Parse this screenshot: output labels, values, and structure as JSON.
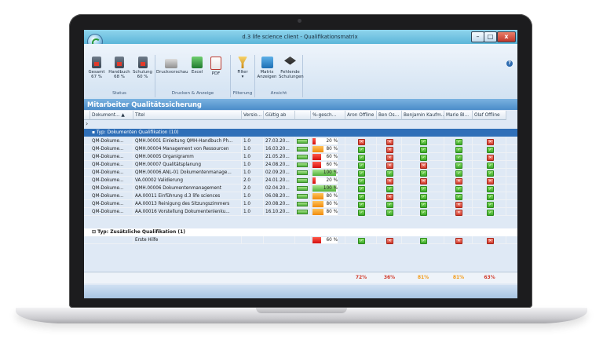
{
  "window": {
    "title": "d.3 life science client - Qualifikationsmatrix",
    "minimize": "–",
    "maximize": "□",
    "close": "x",
    "help": "?"
  },
  "ribbon": {
    "status": {
      "caption": "Status",
      "buttons": [
        {
          "label": "Gesamt",
          "value": "67 %"
        },
        {
          "label": "Handbuch",
          "value": "68 %"
        },
        {
          "label": "Schulung",
          "value": "60 %"
        }
      ]
    },
    "drucken": {
      "caption": "Drucken & Anzeige",
      "buttons": [
        {
          "label": "Druckvorschau"
        },
        {
          "label": "Excel"
        },
        {
          "label": "PDF"
        }
      ]
    },
    "filterung": {
      "caption": "Filterung",
      "buttons": [
        {
          "label": "Filter"
        }
      ]
    },
    "ansicht": {
      "caption": "Ansicht",
      "buttons": [
        {
          "label": "Matrix",
          "label2": "Anzeigen"
        },
        {
          "label": "Fehlende",
          "label2": "Schulungen"
        }
      ]
    }
  },
  "section_title": "Mitarbeiter Qualitätssicherung",
  "grid": {
    "headers": [
      "Dokument... ▲",
      "Titel",
      "Versio...",
      "Gültig ab",
      "",
      "%-gesch...",
      "Aron Offline",
      "Ben Os...",
      "Benjamin Kaufm...",
      "Marie Bl...",
      "Olaf Offline"
    ],
    "group1": "Typ: Dokumenten Qualifikation (10)",
    "rows": [
      {
        "typ": "QM-Dokume...",
        "titel": "QMH.00001 Einleitung QMH-Handbuch Ph...",
        "version": "1.0",
        "gueltig": "27.03.20...",
        "pct": 20,
        "pct_text": "20 %",
        "marks": [
          "bad",
          "bad",
          "ok",
          "ok",
          "bad"
        ]
      },
      {
        "typ": "QM-Dokume...",
        "titel": "QMH.00004 Management von Ressourcen",
        "version": "1.0",
        "gueltig": "16.03.20...",
        "pct": 80,
        "pct_text": "80 %",
        "marks": [
          "ok",
          "bad",
          "ok",
          "ok",
          "ok"
        ]
      },
      {
        "typ": "QM-Dokume...",
        "titel": "QMH.00005 Organigramm",
        "version": "1.0",
        "gueltig": "21.05.20...",
        "pct": 60,
        "pct_text": "60 %",
        "marks": [
          "ok",
          "bad",
          "ok",
          "ok",
          "bad"
        ]
      },
      {
        "typ": "QM-Dokume...",
        "titel": "QMH.00007 Qualitätsplanung",
        "version": "1.0",
        "gueltig": "24.08.20...",
        "pct": 60,
        "pct_text": "60 %",
        "marks": [
          "ok",
          "bad",
          "bad",
          "ok",
          "ok"
        ]
      },
      {
        "typ": "QM-Dokume...",
        "titel": "QMH.00006.ANL-01 Dokumentenmanage...",
        "version": "1.0",
        "gueltig": "02.09.20...",
        "pct": 100,
        "pct_text": "100 %",
        "marks": [
          "ok",
          "ok",
          "ok",
          "ok",
          "ok"
        ]
      },
      {
        "typ": "QM-Dokume...",
        "titel": "VA.00002 Validierung",
        "version": "2.0",
        "gueltig": "24.01.20...",
        "pct": 20,
        "pct_text": "20 %",
        "marks": [
          "ok",
          "bad",
          "bad",
          "bad",
          "bad"
        ]
      },
      {
        "typ": "QM-Dokume...",
        "titel": "QMH.00006 Dokumentenmanagement",
        "version": "2.0",
        "gueltig": "02.04.20...",
        "pct": 100,
        "pct_text": "100 %",
        "marks": [
          "ok",
          "ok",
          "ok",
          "ok",
          "ok"
        ]
      },
      {
        "typ": "QM-Dokume...",
        "titel": "AA.00011 Einführung d.3 life sciences",
        "version": "1.0",
        "gueltig": "06.08.20...",
        "pct": 80,
        "pct_text": "80 %",
        "marks": [
          "ok",
          "bad",
          "ok",
          "ok",
          "ok"
        ]
      },
      {
        "typ": "QM-Dokume...",
        "titel": "AA.00013 Reinigung des Sitzungszimmers",
        "version": "1.0",
        "gueltig": "20.08.20...",
        "pct": 80,
        "pct_text": "80 %",
        "marks": [
          "ok",
          "ok",
          "ok",
          "bad",
          "ok"
        ]
      },
      {
        "typ": "QM-Dokume...",
        "titel": "AA.00016 Vorstellung Dokumentenlenku...",
        "version": "1.0",
        "gueltig": "16.10.20...",
        "pct": 80,
        "pct_text": "80 %",
        "marks": [
          "ok",
          "ok",
          "ok",
          "bad",
          "ok"
        ]
      }
    ],
    "group2": "Typ: Zusätzliche Qualifikation (1)",
    "extra_row": {
      "titel": "Erste Hilfe",
      "pct": 60,
      "pct_text": "60 %",
      "marks": [
        "ok",
        "bad",
        "ok",
        "bad",
        "bad"
      ]
    },
    "totals": [
      "72%",
      "36%",
      "81%",
      "81%",
      "63%"
    ]
  },
  "colors": {
    "good": "#3aa826",
    "bad": "#d23a2a",
    "warn": "#f39a16",
    "purple": "#b256e0",
    "section": "#4b8cc9",
    "group": "#2f6fb8"
  }
}
